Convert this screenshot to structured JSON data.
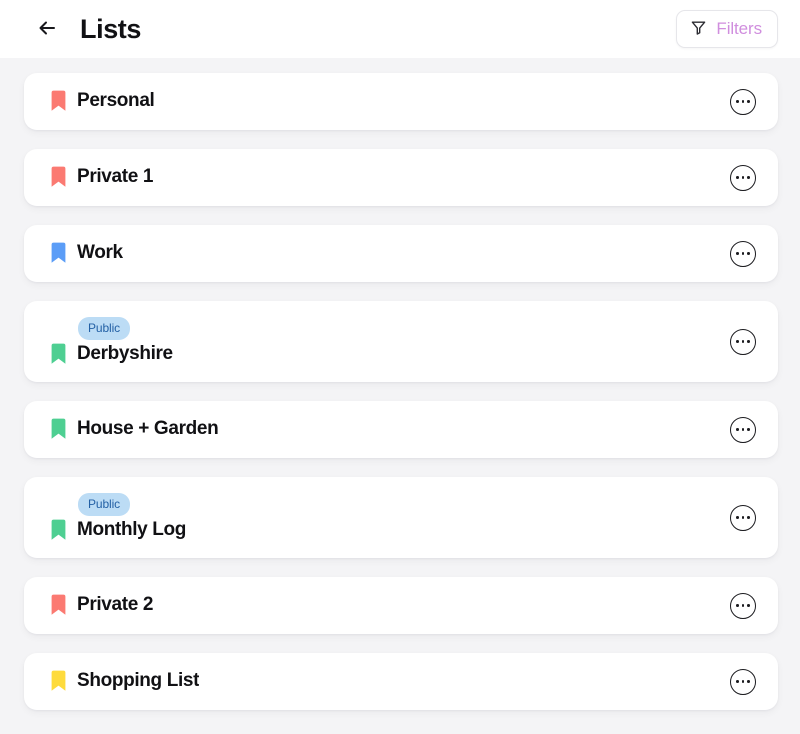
{
  "header": {
    "back_icon": "arrow-left-icon",
    "title": "Lists",
    "filters": {
      "icon": "funnel-icon",
      "label": "Filters",
      "color": "#d08ede"
    }
  },
  "colors": {
    "background": "#f4f4f6",
    "card": "#ffffff",
    "text": "#111114",
    "badge_bg": "#bcdcf5",
    "badge_text": "#2360a5",
    "bookmark_red": "#fb7a72",
    "bookmark_blue": "#5b9df7",
    "bookmark_green": "#4ecf92",
    "bookmark_yellow": "#fedb3d"
  },
  "more_menu": {
    "icon": "ellipsis-circle-icon"
  },
  "lists": [
    {
      "name": "Personal",
      "bookmark_color": "#fb7a72",
      "bookmark_name": "bookmark-icon-red",
      "badge": null
    },
    {
      "name": "Private 1",
      "bookmark_color": "#fb7a72",
      "bookmark_name": "bookmark-icon-red",
      "badge": null
    },
    {
      "name": "Work",
      "bookmark_color": "#5b9df7",
      "bookmark_name": "bookmark-icon-blue",
      "badge": null
    },
    {
      "name": "Derbyshire",
      "bookmark_color": "#4ecf92",
      "bookmark_name": "bookmark-icon-green",
      "badge": "Public"
    },
    {
      "name": "House + Garden",
      "bookmark_color": "#4ecf92",
      "bookmark_name": "bookmark-icon-green",
      "badge": null
    },
    {
      "name": "Monthly Log",
      "bookmark_color": "#4ecf92",
      "bookmark_name": "bookmark-icon-green",
      "badge": "Public"
    },
    {
      "name": "Private 2",
      "bookmark_color": "#fb7a72",
      "bookmark_name": "bookmark-icon-red",
      "badge": null
    },
    {
      "name": "Shopping List",
      "bookmark_color": "#fedb3d",
      "bookmark_name": "bookmark-icon-yellow",
      "badge": null
    }
  ]
}
